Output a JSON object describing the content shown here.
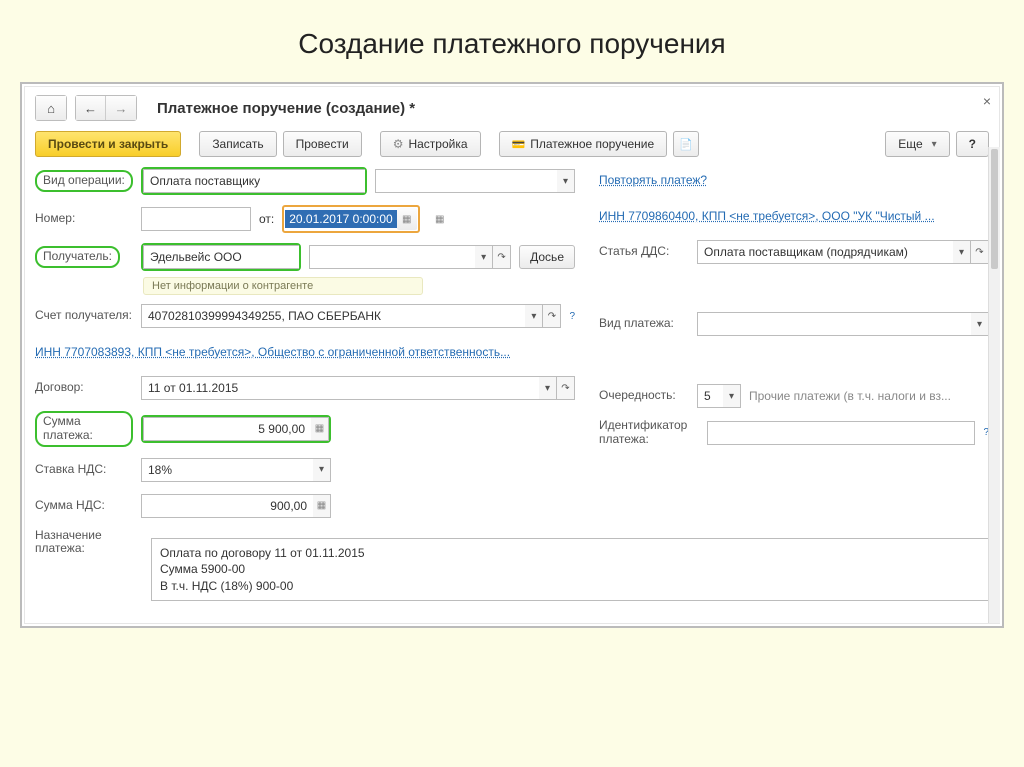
{
  "slide_title": "Создание платежного поручения",
  "window_title": "Платежное поручение (создание) *",
  "toolbar": {
    "post_close": "Провести и закрыть",
    "save": "Записать",
    "post": "Провести",
    "settings": "Настройка",
    "print_po": "Платежное поручение",
    "more": "Еще",
    "help": "?"
  },
  "labels": {
    "op_type": "Вид операции:",
    "number": "Номер:",
    "date_from": "от:",
    "receiver": "Получатель:",
    "dossier": "Досье",
    "no_info": "Нет информации о контрагенте",
    "rcpt_account": "Счет получателя:",
    "contract": "Договор:",
    "amount": "Сумма платежа:",
    "vat_rate": "Ставка НДС:",
    "vat_sum": "Сумма НДС:",
    "purpose": "Назначение платежа:",
    "repeat_link": "Повторять платеж?",
    "inn_link": "ИНН 7709860400, КПП <не требуется>, ООО \"УК \"Чистый ...",
    "dds": "Статья ДДС:",
    "pay_type": "Вид платежа:",
    "priority": "Очередность:",
    "priority_note": "Прочие платежи (в т.ч. налоги и вз...",
    "pay_id": "Идентификатор платежа:",
    "org_link": "ИНН 7707083893, КПП <не требуется>, Общество с ограниченной ответственность..."
  },
  "values": {
    "op_type": "Оплата поставщику",
    "number": "",
    "date": "20.01.2017  0:00:00",
    "receiver": "Эдельвейс ООО",
    "rcpt_account": "40702810399994349255, ПАО СБЕРБАНК",
    "contract": "11 от 01.11.2015",
    "amount": "5 900,00",
    "vat_rate": "18%",
    "vat_sum": "900,00",
    "dds": "Оплата поставщикам (подрядчикам)",
    "pay_type": "",
    "priority": "5",
    "pay_id": "",
    "purpose_l1": "Оплата по договору 11 от 01.11.2015",
    "purpose_l2": "Сумма 5900-00",
    "purpose_l3": "В т.ч. НДС  (18%) 900-00"
  }
}
